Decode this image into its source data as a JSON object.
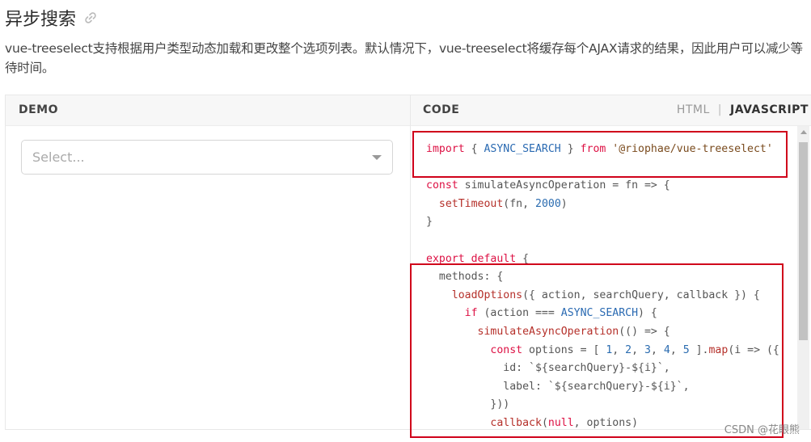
{
  "page": {
    "title": "异步搜索",
    "link_icon": "link-icon",
    "description": "vue-treeselect支持根据用户类型动态加载和更改整个选项列表。默认情况下，vue-treeselect将缓存每个AJAX请求的结果，因此用户可以减少等待时间。"
  },
  "panel": {
    "demo_label": "DEMO",
    "code_label": "CODE",
    "tabs": {
      "html": "HTML",
      "separator": "|",
      "javascript": "JAVASCRIPT"
    },
    "active_tab": "JAVASCRIPT"
  },
  "demo": {
    "select_placeholder": "Select...",
    "arrow_icon": "caret-down-icon"
  },
  "code": {
    "lines": [
      [
        [
          "kw",
          "import"
        ],
        [
          "pl",
          " { "
        ],
        [
          "cn",
          "ASYNC_SEARCH"
        ],
        [
          "pl",
          " } "
        ],
        [
          "kw",
          "from"
        ],
        [
          "pl",
          " "
        ],
        [
          "st",
          "'@riophae/vue-treeselect'"
        ]
      ],
      [],
      [
        [
          "kw",
          "const"
        ],
        [
          "pl",
          " simulateAsyncOperation = fn => {"
        ]
      ],
      [
        [
          "pl",
          "  "
        ],
        [
          "fn",
          "setTimeout"
        ],
        [
          "pl",
          "(fn, "
        ],
        [
          "nm",
          "2000"
        ],
        [
          "pl",
          ")"
        ]
      ],
      [
        [
          "pl",
          "}"
        ]
      ],
      [],
      [
        [
          "kw",
          "export"
        ],
        [
          "pl",
          " "
        ],
        [
          "kw",
          "default"
        ],
        [
          "pl",
          " {"
        ]
      ],
      [
        [
          "pl",
          "  methods: {"
        ]
      ],
      [
        [
          "pl",
          "    "
        ],
        [
          "fn",
          "loadOptions"
        ],
        [
          "pl",
          "({ action, searchQuery, callback }) {"
        ]
      ],
      [
        [
          "pl",
          "      "
        ],
        [
          "kw",
          "if"
        ],
        [
          "pl",
          " (action === "
        ],
        [
          "cn",
          "ASYNC_SEARCH"
        ],
        [
          "pl",
          ") {"
        ]
      ],
      [
        [
          "pl",
          "        "
        ],
        [
          "fn",
          "simulateAsyncOperation"
        ],
        [
          "pl",
          "(() => {"
        ]
      ],
      [
        [
          "pl",
          "          "
        ],
        [
          "kw",
          "const"
        ],
        [
          "pl",
          " options = [ "
        ],
        [
          "nm",
          "1"
        ],
        [
          "pl",
          ", "
        ],
        [
          "nm",
          "2"
        ],
        [
          "pl",
          ", "
        ],
        [
          "nm",
          "3"
        ],
        [
          "pl",
          ", "
        ],
        [
          "nm",
          "4"
        ],
        [
          "pl",
          ", "
        ],
        [
          "nm",
          "5"
        ],
        [
          "pl",
          " ]."
        ],
        [
          "fn",
          "map"
        ],
        [
          "pl",
          "(i => ({"
        ]
      ],
      [
        [
          "pl",
          "            id: `${searchQuery}-${i}`,"
        ]
      ],
      [
        [
          "pl",
          "            label: `${searchQuery}-${i}`,"
        ]
      ],
      [
        [
          "pl",
          "          }))"
        ]
      ],
      [
        [
          "pl",
          "          "
        ],
        [
          "fn",
          "callback"
        ],
        [
          "pl",
          "("
        ],
        [
          "kw",
          "null"
        ],
        [
          "pl",
          ", options)"
        ]
      ]
    ]
  },
  "colors": {
    "highlight_box": "#d0021b",
    "keyword": "#cc3300",
    "constant": "#2a6ab2"
  },
  "watermark": "CSDN @花眼熊"
}
